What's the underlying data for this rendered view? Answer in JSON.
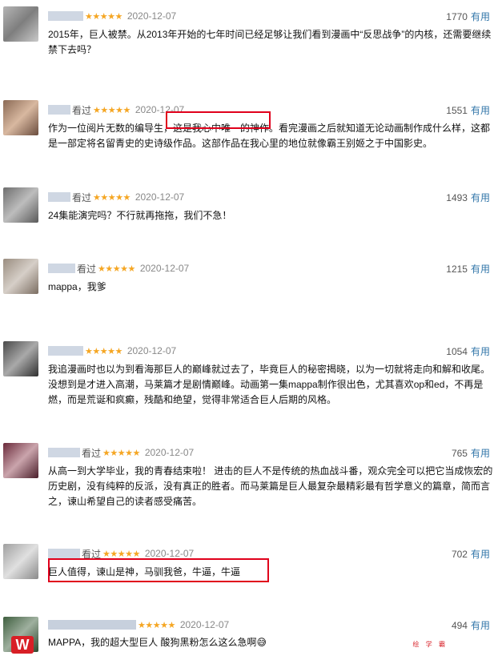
{
  "reviews": [
    {
      "watched": "",
      "date": "2020-12-07",
      "votes": "1770",
      "useful": "有用",
      "text": "2015年，巨人被禁。从2013年开始的七年时间已经足够让我们看到漫画中“反思战争”的内核，还需要继续禁下去吗？"
    },
    {
      "watched": "看过",
      "date": "2020-12-07",
      "votes": "1551",
      "useful": "有用",
      "text": "作为一位阅片无数的编导生，这是我心中唯一的神作。看完漫画之后就知道无论动画制作成什么样，这都是一部定将名留青史的史诗级作品。这部作品在我心里的地位就像霸王别姬之于中国影史。"
    },
    {
      "watched": "看过",
      "date": "2020-12-07",
      "votes": "1493",
      "useful": "有用",
      "text": "24集能演完吗？不行就再拖拖，我们不急！"
    },
    {
      "watched": "看过",
      "date": "2020-12-07",
      "votes": "1215",
      "useful": "有用",
      "text": "mappa，我爹"
    },
    {
      "watched": "",
      "date": "2020-12-07",
      "votes": "1054",
      "useful": "有用",
      "text": "我追漫画时也以为到看海那巨人的巅峰就过去了，毕竟巨人的秘密揭晓，以为一切就将走向和解和收尾。没想到是才进入高潮，马莱篇才是剧情巅峰。动画第一集mappa制作很出色，尤其喜欢op和ed，不再是燃，而是荒诞和疯癫，残酷和绝望，觉得非常适合巨人后期的风格。"
    },
    {
      "watched": "看过",
      "date": "2020-12-07",
      "votes": "765",
      "useful": "有用",
      "text": "从高一到大学毕业，我的青春结束啦！ 进击的巨人不是传统的热血战斗番，观众完全可以把它当成恢宏的历史剧，没有纯粹的反派，没有真正的胜者。而马莱篇是巨人最复杂最精彩最有哲学意义的篇章，简而言之，谏山希望自己的读者感受痛苦。"
    },
    {
      "watched": "看过",
      "date": "2020-12-07",
      "votes": "702",
      "useful": "有用",
      "text": "巨人值得，谏山是神，马驯我爸，牛逼，牛逼"
    },
    {
      "watched": "",
      "date": "2020-12-07",
      "votes": "494",
      "useful": "有用",
      "text": "MAPPA，我的超大型巨人 酸狗黑粉怎么这么急啊😅"
    }
  ],
  "stars": "★★★★★",
  "watermark": "绘 学 霸",
  "colors": {
    "star": "#f5a623",
    "link": "#3377aa",
    "highlight": "#e0001b"
  }
}
